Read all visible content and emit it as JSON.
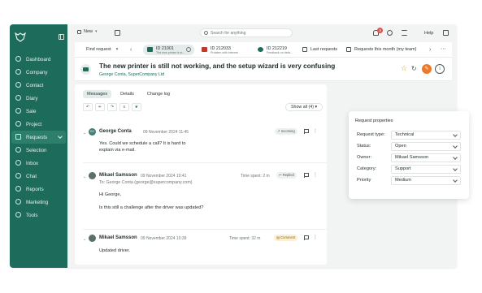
{
  "sidebar": {
    "items": [
      {
        "label": "Dashboard"
      },
      {
        "label": "Company"
      },
      {
        "label": "Contact"
      },
      {
        "label": "Diary"
      },
      {
        "label": "Sale"
      },
      {
        "label": "Project"
      },
      {
        "label": "Requests"
      },
      {
        "label": "Selection"
      },
      {
        "label": "Inbox"
      },
      {
        "label": "Chat"
      },
      {
        "label": "Reports"
      },
      {
        "label": "Marketing"
      },
      {
        "label": "Tools"
      }
    ],
    "active": "Requests"
  },
  "topbar": {
    "new_label": "New",
    "search_placeholder": "Search for anything",
    "notification_count": "3",
    "help_label": "Help"
  },
  "tabs": {
    "find_label": "Find request",
    "requests": [
      {
        "id": "ID 21001",
        "sub": "The new printer is st..."
      },
      {
        "id": "ID 212033",
        "sub": "Problem with internet"
      },
      {
        "id": "ID 212219",
        "sub": "Feedback on deliv..."
      }
    ],
    "last_requests": "Last requests",
    "this_month": "Requests this month (my team)"
  },
  "request": {
    "title": "The new printer is still not working, and the setup wizard is very confusing",
    "contact": "George Conta, SuperCompany Ltd"
  },
  "subtabs": [
    "Messages",
    "Details",
    "Change log"
  ],
  "show_all": "Show all (4)",
  "messages": [
    {
      "author": "George Conta",
      "initials": "GC",
      "date": "09 November 2024 11:45",
      "tag": "Incoming",
      "body": [
        "Yes. Could we schedule a call? It is hard to",
        "explain via e-mail."
      ]
    },
    {
      "author": "Mikael Samsson",
      "date": "09 November 2024 10:41",
      "spent": "Time spent: 2 m",
      "tag": "Replied",
      "to": "To: George Conta (george@supercompany.com)",
      "body": [
        "Hi George,",
        "Is this still a challenge after the driver was updated?"
      ]
    },
    {
      "author": "Mikael Samsson",
      "date": "09 November 2024 10:39",
      "spent": "Time spent: 32 m",
      "tag": "Comment",
      "body": [
        "Updated driver."
      ]
    }
  ],
  "properties": {
    "title": "Request properties",
    "rows": [
      {
        "label": "Request type:",
        "value": "Technical"
      },
      {
        "label": "Status:",
        "value": "Open"
      },
      {
        "label": "Owner:",
        "value": "Mikael Samsson"
      },
      {
        "label": "Category:",
        "value": "Support"
      },
      {
        "label": "Priority",
        "value": "Medium"
      }
    ]
  },
  "colors": {
    "brand": "#1d6b5a",
    "accent": "#ec7a2b",
    "badge": "#d9534f"
  }
}
